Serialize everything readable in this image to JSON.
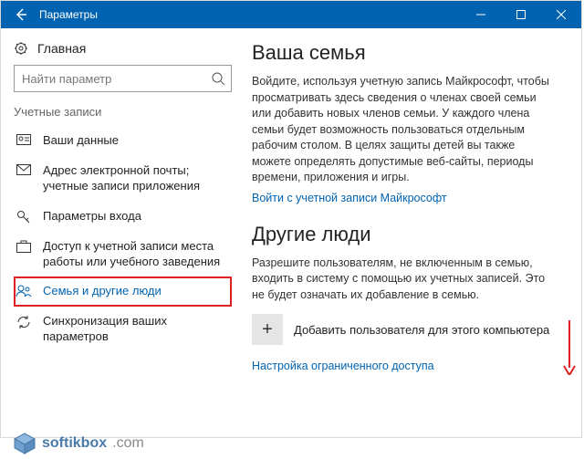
{
  "window": {
    "title": "Параметры"
  },
  "sidebar": {
    "home": "Главная",
    "search_placeholder": "Найти параметр",
    "section": "Учетные записи",
    "items": [
      {
        "label": "Ваши данные"
      },
      {
        "label": "Адрес электронной почты; учетные записи приложения"
      },
      {
        "label": "Параметры входа"
      },
      {
        "label": "Доступ к учетной записи места работы или учебного заведения"
      },
      {
        "label": "Семья и другие люди"
      },
      {
        "label": "Синхронизация ваших параметров"
      }
    ]
  },
  "main": {
    "family": {
      "title": "Ваша семья",
      "body": "Войдите, используя учетную запись Майкрософт, чтобы просматривать здесь сведения о членах своей семьи или добавить новых членов семьи. У каждого члена семьи будет возможность пользоваться отдельным рабочим столом. В целях защиты детей вы также можете определять допустимые веб-сайты, периоды времени, приложения и игры.",
      "signin_link": "Войти с учетной записи Майкрософт"
    },
    "others": {
      "title": "Другие люди",
      "body": "Разрешите пользователям, не включенным в семью, входить в систему с помощью их учетных записей. Это не будет означать их добавление в семью.",
      "add_label": "Добавить пользователя для этого компьютера",
      "restricted_link": "Настройка ограниченного доступа"
    }
  },
  "watermark": {
    "brand1": "softikbox",
    "brand2": ".com"
  }
}
